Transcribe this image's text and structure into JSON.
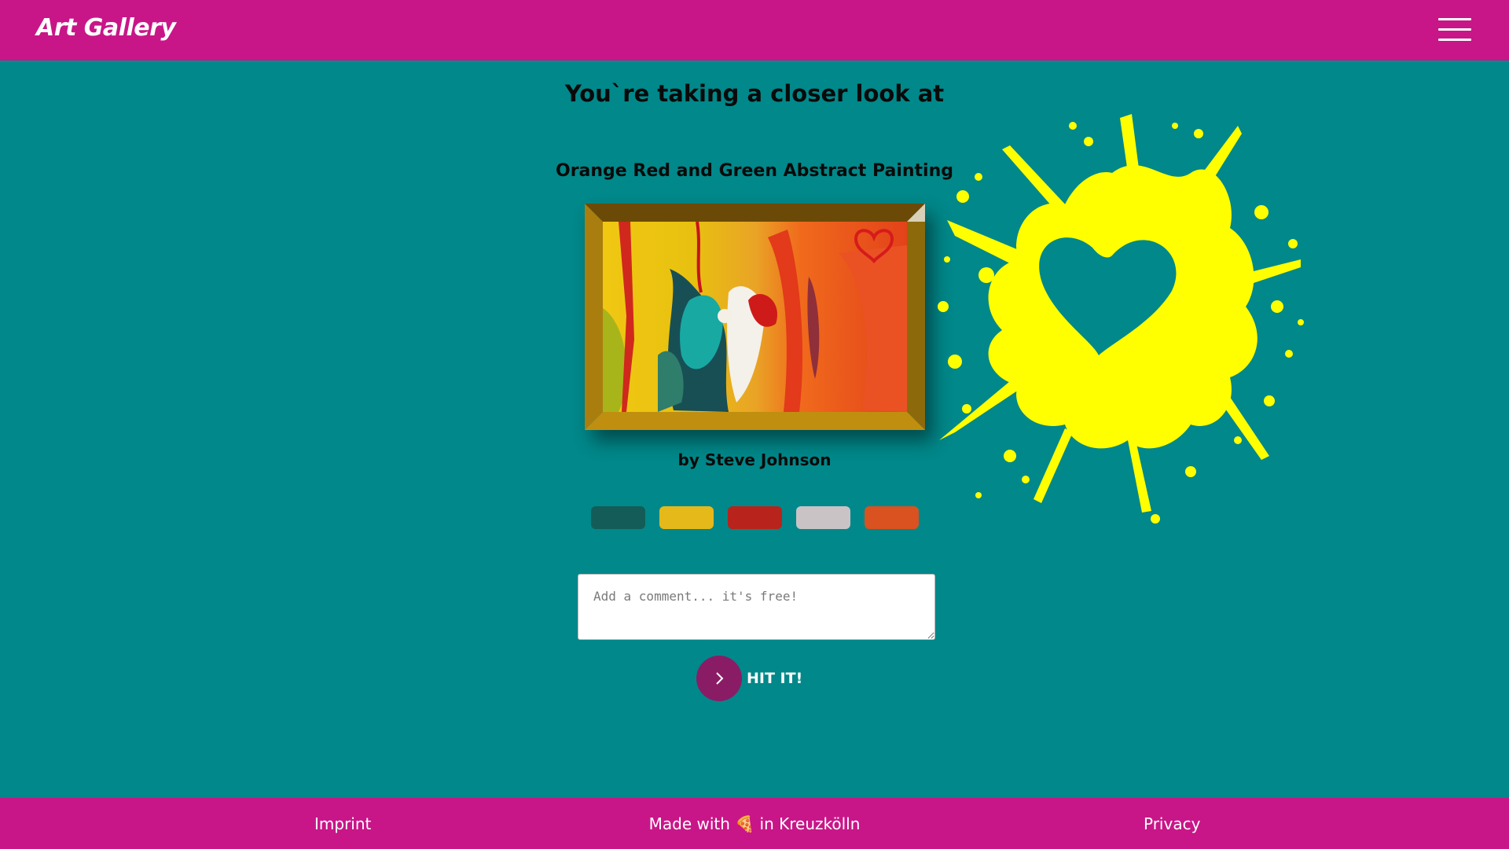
{
  "header": {
    "logo": "Art Gallery",
    "menu_icon": "hamburger-menu-icon"
  },
  "main": {
    "heading": "You`re taking a closer look at",
    "artwork_title": "Orange Red and Green Abstract Painting",
    "artist": "by Steve Johnson",
    "palette": [
      {
        "name": "swatch-dark-teal",
        "color": "#135c57"
      },
      {
        "name": "swatch-mustard",
        "color": "#e4b919"
      },
      {
        "name": "swatch-red",
        "color": "#b8231b"
      },
      {
        "name": "swatch-light-gray",
        "color": "#cac3c5"
      },
      {
        "name": "swatch-orange",
        "color": "#d9521f"
      }
    ],
    "favorite_icon": "heart-splash-icon",
    "comment": {
      "placeholder": "Add a comment... it's free!",
      "value": ""
    },
    "submit_label": "HIT IT!"
  },
  "footer": {
    "imprint": "Imprint",
    "made_with": "Made with 🍕 in Kreuzkölln",
    "privacy": "Privacy"
  },
  "colors": {
    "header_bg": "#c81688",
    "page_bg": "#01888a",
    "splash": "#ffff00",
    "button": "#8a1c66",
    "frame": "#b98a12"
  }
}
